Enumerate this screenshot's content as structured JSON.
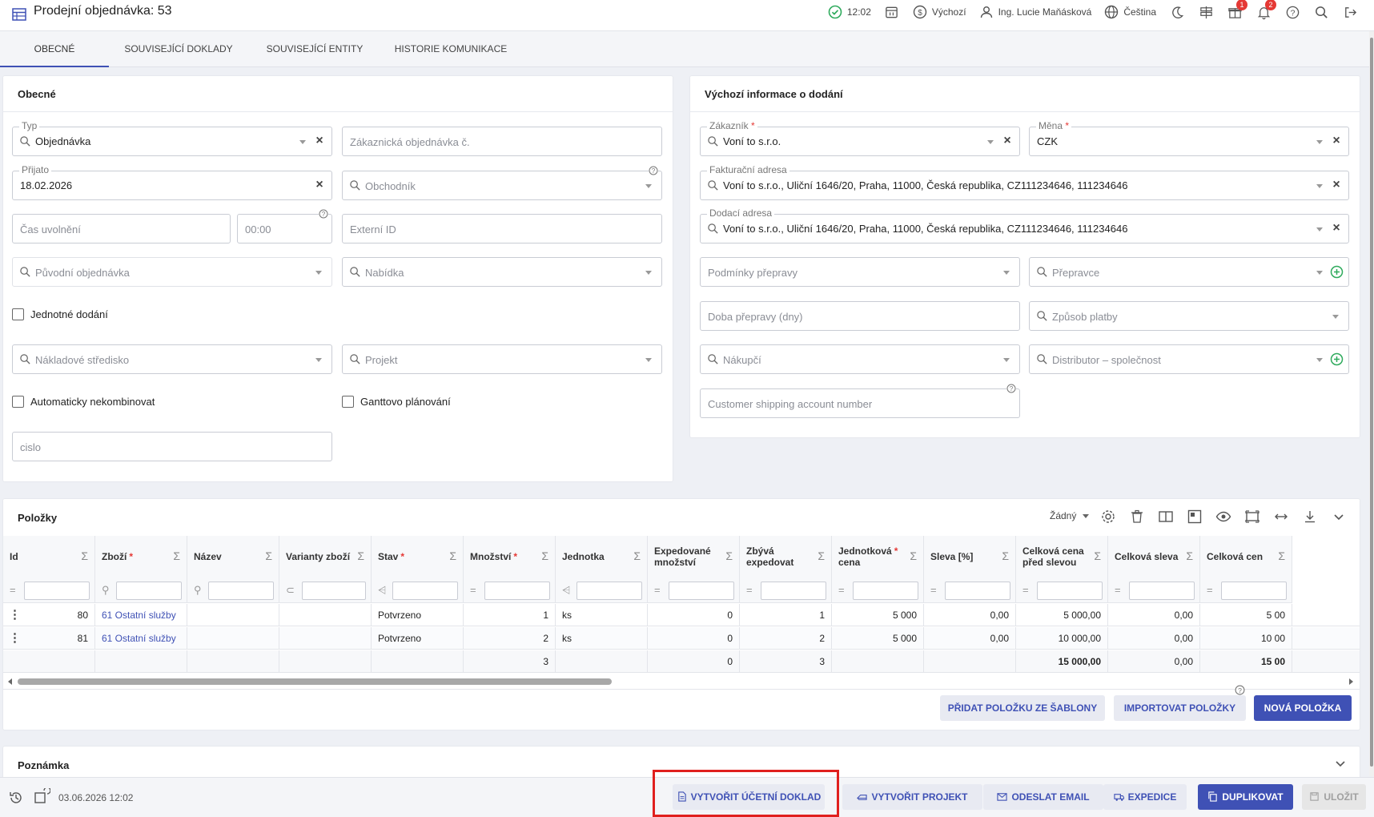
{
  "header": {
    "title": "Prodejní objednávka: 53",
    "time": "12:02",
    "warehouse": "Výchozí",
    "user": "Ing. Lucie Maňásková",
    "language": "Čeština",
    "gift_badge": "1",
    "bell_badge": "2"
  },
  "tabs": [
    "OBECNÉ",
    "SOUVISEJÍCÍ DOKLADY",
    "SOUVISEJÍCÍ ENTITY",
    "HISTORIE KOMUNIKACE"
  ],
  "general": {
    "title": "Obecné",
    "typ_label": "Typ",
    "typ_value": "Objednávka",
    "zak_obj_ph": "Zákaznická objednávka č.",
    "prijato_label": "Přijato",
    "prijato_value": "18.02.2026",
    "obchodnik_ph": "Obchodník",
    "cas_ph": "Čas uvolnění",
    "time_ph": "00:00",
    "externi_ph": "Externí ID",
    "puvodni_ph": "Původní objednávka",
    "nabidka_ph": "Nabídka",
    "jednotne": "Jednotné dodání",
    "naklad_ph": "Nákladové středisko",
    "projekt_ph": "Projekt",
    "auto": "Automaticky nekombinovat",
    "gantt": "Ganttovo plánování",
    "cislo_ph": "cislo"
  },
  "delivery": {
    "title": "Výchozí informace o dodání",
    "zakaznik_label": "Zákazník",
    "zakaznik_value": "Voní to s.r.o.",
    "mena_label": "Měna",
    "mena_value": "CZK",
    "fakt_label": "Fakturační adresa",
    "fakt_value": "Voní to s.r.o., Uliční 1646/20, Praha, 11000, Česká republika, CZ111234646, 111234646",
    "dod_label": "Dodací adresa",
    "dod_value": "Voní to s.r.o., Uliční 1646/20, Praha, 11000, Česká republika, CZ111234646, 111234646",
    "podminky_ph": "Podmínky přepravy",
    "prepravce_ph": "Přepravce",
    "doba_ph": "Doba přepravy (dny)",
    "zpusob_ph": "Způsob platby",
    "nakupci_ph": "Nákupčí",
    "distributor_ph": "Distributor – společnost",
    "customer_ph": "Customer shipping account number"
  },
  "items": {
    "title": "Položky",
    "view": "Žádný",
    "columns": [
      {
        "l1": "Id",
        "l2": ""
      },
      {
        "l1": "Zboží",
        "l2": "",
        "req": "*"
      },
      {
        "l1": "Název",
        "l2": ""
      },
      {
        "l1": "Varianty zboží",
        "l2": ""
      },
      {
        "l1": "Stav",
        "l2": "",
        "req": "*"
      },
      {
        "l1": "Množství",
        "l2": "",
        "req": "*"
      },
      {
        "l1": "Jednotka",
        "l2": ""
      },
      {
        "l1": "Expedované",
        "l2": "množství"
      },
      {
        "l1": "Zbývá",
        "l2": "expedovat"
      },
      {
        "l1": "Jednotková",
        "l2": "cena",
        "req": "*"
      },
      {
        "l1": "Sleva [%]",
        "l2": ""
      },
      {
        "l1": "Celková cena",
        "l2": "před slevou"
      },
      {
        "l1": "Celková sleva",
        "l2": ""
      },
      {
        "l1": "Celková cen",
        "l2": ""
      }
    ],
    "rows": [
      [
        "80",
        "61 Ostatní služby",
        "",
        "",
        "Potvrzeno",
        "1",
        "ks",
        "0",
        "1",
        "5 000",
        "0,00",
        "5 000,00",
        "0,00",
        "5 00"
      ],
      [
        "81",
        "61 Ostatní služby",
        "",
        "",
        "Potvrzeno",
        "2",
        "ks",
        "0",
        "2",
        "5 000",
        "0,00",
        "10 000,00",
        "0,00",
        "10 00"
      ]
    ],
    "totals": [
      "",
      "",
      "",
      "",
      "",
      "3",
      "",
      "0",
      "3",
      "",
      "",
      "15 000,00",
      "0,00",
      "15 00"
    ],
    "btn_template": "PŘIDAT POLOŽKU ZE ŠABLONY",
    "btn_import": "IMPORTOVAT POLOŽKY",
    "btn_new": "NOVÁ POLOŽKA"
  },
  "note": {
    "title": "Poznámka"
  },
  "footer": {
    "timestamp": "03.06.2026 12:02",
    "btn_ucetni": "VYTVOŘIT ÚČETNÍ DOKLAD",
    "btn_projekt": "VYTVOŘIT PROJEKT",
    "btn_email": "ODESLAT EMAIL",
    "btn_expedice": "EXPEDICE",
    "btn_dup": "DUPLIKOVAT",
    "btn_save": "ULOŽIT"
  },
  "colors": {
    "accent": "#3f51b5",
    "danger": "#e53935",
    "success": "#2eaa5c",
    "highlight": "#e0201e"
  }
}
